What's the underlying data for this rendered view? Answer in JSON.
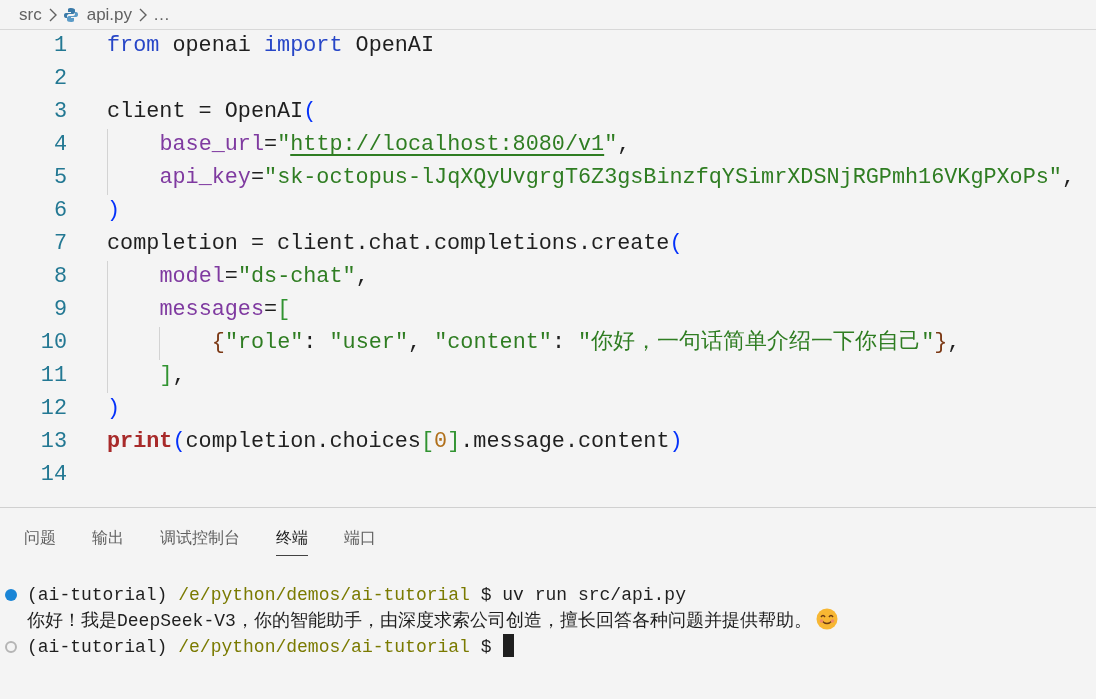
{
  "breadcrumb": [
    {
      "kind": "folder",
      "label": "src"
    },
    {
      "kind": "python-file",
      "label": "api.py"
    },
    {
      "kind": "more",
      "label": "…"
    }
  ],
  "editor": {
    "lines": [
      {
        "number": "1",
        "tokens": [
          {
            "kind": "keyword",
            "text": "from"
          },
          {
            "kind": "plain",
            "text": " openai "
          },
          {
            "kind": "keyword",
            "text": "import"
          },
          {
            "kind": "plain",
            "text": " OpenAI"
          }
        ]
      },
      {
        "number": "2"
      },
      {
        "number": "3",
        "tokens": [
          {
            "kind": "plain",
            "text": "client = OpenAI"
          },
          {
            "kind": "bracket1",
            "text": "("
          }
        ],
        "children": [
          {
            "number": "4",
            "tokens": [
              {
                "kind": "param",
                "text": "base_url"
              },
              {
                "kind": "plain",
                "text": "="
              },
              {
                "kind": "string",
                "text": "\""
              },
              {
                "kind": "link",
                "text": "http://localhost:8080/v1"
              },
              {
                "kind": "string",
                "text": "\""
              },
              {
                "kind": "plain",
                "text": ","
              }
            ]
          },
          {
            "number": "5",
            "tokens": [
              {
                "kind": "param",
                "text": "api_key"
              },
              {
                "kind": "plain",
                "text": "="
              },
              {
                "kind": "string",
                "text": "\"sk-octopus-lJqXQyUvgrgT6Z3gsBinzfqYSimrXDSNjRGPmh16VKgPXoPs\""
              },
              {
                "kind": "plain",
                "text": ","
              }
            ]
          }
        ]
      },
      {
        "number": "6",
        "tokens": [
          {
            "kind": "bracket1",
            "text": ")"
          }
        ]
      },
      {
        "number": "7",
        "tokens": [
          {
            "kind": "plain",
            "text": "completion = client.chat.completions.create"
          },
          {
            "kind": "bracket1",
            "text": "("
          }
        ],
        "children": [
          {
            "number": "8",
            "tokens": [
              {
                "kind": "param",
                "text": "model"
              },
              {
                "kind": "plain",
                "text": "="
              },
              {
                "kind": "string",
                "text": "\"ds-chat\""
              },
              {
                "kind": "plain",
                "text": ","
              }
            ]
          },
          {
            "number": "9",
            "tokens": [
              {
                "kind": "param",
                "text": "messages"
              },
              {
                "kind": "plain",
                "text": "="
              },
              {
                "kind": "bracket2",
                "text": "["
              }
            ],
            "children": [
              {
                "number": "10",
                "tokens": [
                  {
                    "kind": "bracket3",
                    "text": "{"
                  },
                  {
                    "kind": "string",
                    "text": "\"role\""
                  },
                  {
                    "kind": "plain",
                    "text": ": "
                  },
                  {
                    "kind": "string",
                    "text": "\"user\""
                  },
                  {
                    "kind": "plain",
                    "text": ", "
                  },
                  {
                    "kind": "string",
                    "text": "\"content\""
                  },
                  {
                    "kind": "plain",
                    "text": ": "
                  },
                  {
                    "kind": "string",
                    "text": "\"你好，一句话简单介绍一下你自己\""
                  },
                  {
                    "kind": "bracket3",
                    "text": "}"
                  },
                  {
                    "kind": "plain",
                    "text": ","
                  }
                ]
              }
            ]
          },
          {
            "number": "11",
            "tokens": [
              {
                "kind": "bracket2",
                "text": "]"
              },
              {
                "kind": "plain",
                "text": ","
              }
            ]
          }
        ]
      },
      {
        "number": "12",
        "tokens": [
          {
            "kind": "bracket1",
            "text": ")"
          }
        ]
      },
      {
        "number": "13",
        "tokens": [
          {
            "kind": "builtin",
            "text": "print"
          },
          {
            "kind": "bracket1",
            "text": "("
          },
          {
            "kind": "plain",
            "text": "completion.choices"
          },
          {
            "kind": "bracket2",
            "text": "["
          },
          {
            "kind": "number",
            "text": "0"
          },
          {
            "kind": "bracket2",
            "text": "]"
          },
          {
            "kind": "plain",
            "text": ".message.content"
          },
          {
            "kind": "bracket1",
            "text": ")"
          }
        ]
      },
      {
        "number": "14"
      }
    ]
  },
  "panel": {
    "tabs": [
      {
        "label": "问题",
        "selected": false
      },
      {
        "label": "输出",
        "selected": false
      },
      {
        "label": "调试控制台",
        "selected": false
      },
      {
        "label": "终端",
        "selected": true
      },
      {
        "label": "端口",
        "selected": false
      }
    ],
    "terminal": [
      {
        "kind": "prompt",
        "finished": true,
        "env": "(ai-tutorial)",
        "path": "/e/python/demos/ai-tutorial",
        "command": "$ uv run src/api.py"
      },
      {
        "kind": "output",
        "text": "你好！我是DeepSeek-V3，你的智能助手，由深度求索公司创造，擅长回答各种问题并提供帮助。",
        "emoji": true
      },
      {
        "kind": "prompt",
        "finished": false,
        "env": "(ai-tutorial)",
        "path": "/e/python/demos/ai-tutorial",
        "command": "$",
        "cursor": true
      }
    ]
  }
}
